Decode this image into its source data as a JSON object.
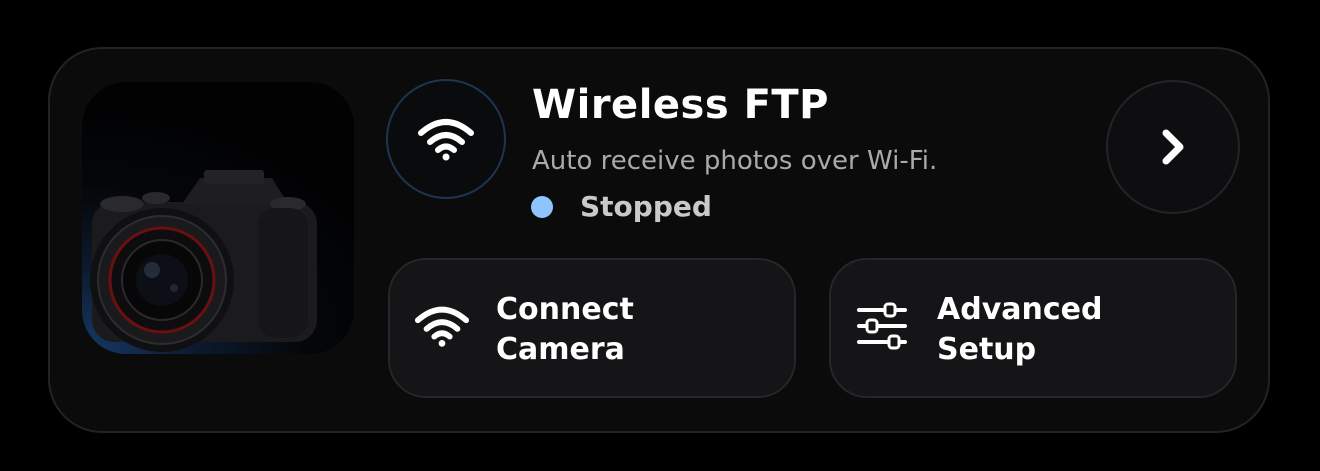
{
  "widget": {
    "title": "Wireless FTP",
    "subtitle": "Auto receive photos over Wi-Fi.",
    "status": {
      "label": "Stopped",
      "color": "#8ec5ff"
    },
    "thumbnail_icon": "camera-icon",
    "header_icon": "wifi-icon",
    "open_icon": "chevron-right-icon",
    "actions": [
      {
        "line1": "Connect",
        "line2": "Camera",
        "icon": "wifi-icon"
      },
      {
        "line1": "Advanced",
        "line2": "Setup",
        "icon": "sliders-icon"
      }
    ],
    "colors": {
      "background": "#000000",
      "card": "#0b0b0c",
      "button": "#151517",
      "accent_ring": "#1d3550",
      "secondary_text": "#a9a9ae"
    }
  }
}
